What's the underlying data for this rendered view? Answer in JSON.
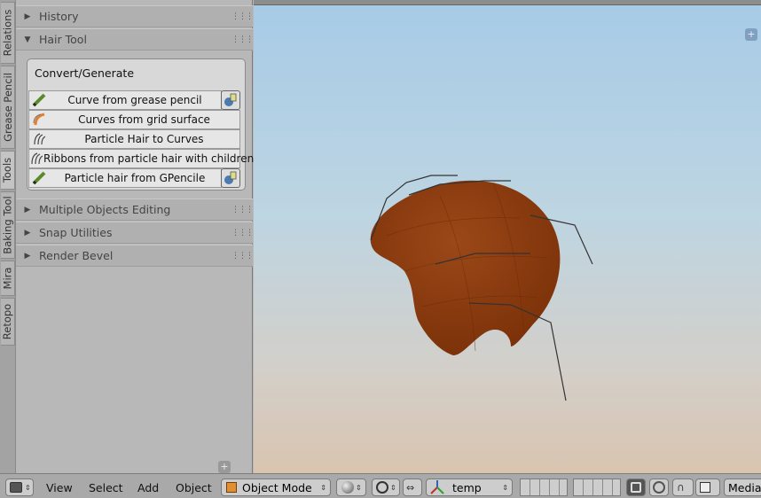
{
  "tabs": [
    "Relations",
    "Grease Pencil",
    "Tools",
    "Baking Tool",
    "Mira",
    "Retopo"
  ],
  "panels": {
    "history": "History",
    "hair_tool": "Hair Tool",
    "multiple_objects": "Multiple Objects Editing",
    "snap": "Snap Utilities",
    "render_bevel": "Render Bevel"
  },
  "convert": {
    "title": "Convert/Generate",
    "buttons": [
      {
        "label": "Curve from grease pencil",
        "icon": "pencil-icon"
      },
      {
        "label": "Curves from grid surface",
        "icon": "curve-icon"
      },
      {
        "label": "Particle Hair to Curves",
        "icon": "hair-icon"
      },
      {
        "label": "Ribbons from particle hair with children",
        "icon": "hair-icon"
      },
      {
        "label": "Particle hair from GPencile",
        "icon": "pencil-icon"
      }
    ]
  },
  "header": {
    "menus": [
      "View",
      "Select",
      "Add",
      "Object"
    ],
    "mode": "Object Mode",
    "layer_name": "temp",
    "pivot_label": "Media"
  },
  "colors": {
    "hair_mesh": "#8b3d12",
    "panel_bg": "#b8b8b8",
    "header_bg": "#a9a9a9"
  }
}
